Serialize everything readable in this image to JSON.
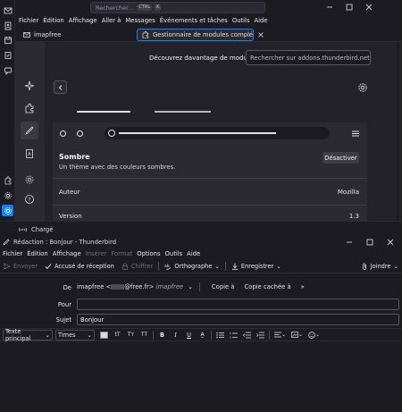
{
  "main": {
    "search_placeholder": "Rechercher…",
    "search_kbd": [
      "CTRL",
      "K"
    ],
    "menu": [
      "Fichier",
      "Édition",
      "Affichage",
      "Aller à",
      "Messages",
      "Événements et tâches",
      "Outils",
      "Aide"
    ],
    "tabs": [
      {
        "label": "imapfree",
        "icon": "mail-folder-icon"
      },
      {
        "label": "Gestionnaire de modules complém",
        "icon": "puzzle-icon"
      }
    ],
    "addons": {
      "discover_label": "Découvrez davantage de modules",
      "search_placeholder": "Rechercher sur addons.thunderbird.net",
      "theme": {
        "name": "Sombre",
        "description": "Un thème avec des couleurs sombres.",
        "disable_label": "Désactiver",
        "rows": [
          {
            "label": "Auteur",
            "value": "Mozilla"
          },
          {
            "label": "Version",
            "value": "1.3"
          }
        ]
      }
    },
    "status": "Chargé",
    "colors": {
      "accent": "#0a84ff",
      "bg": "#1c1b22",
      "panel": "#2b2a33"
    }
  },
  "compose": {
    "title": "Rédaction : Bonjour - Thunderbird",
    "menu": [
      {
        "label": "Fichier",
        "disabled": false
      },
      {
        "label": "Édition",
        "disabled": false
      },
      {
        "label": "Affichage",
        "disabled": false
      },
      {
        "label": "Insérer",
        "disabled": true
      },
      {
        "label": "Format",
        "disabled": true
      },
      {
        "label": "Options",
        "disabled": false
      },
      {
        "label": "Outils",
        "disabled": false
      },
      {
        "label": "Aide",
        "disabled": false
      }
    ],
    "toolbar": {
      "send": "Envoyer",
      "receipt": "Accusé de réception",
      "encrypt": "Chiffrer",
      "spell": "Orthographe",
      "save": "Enregistrer",
      "attach": "Joindre"
    },
    "headers": {
      "from_label": "De",
      "from_name": "imapfree <",
      "from_domain": "@free.fr>",
      "from_account": "imapfree",
      "cc": "Copie à",
      "bcc": "Copie cachée à",
      "more": "»",
      "to_label": "Pour",
      "to_value": "",
      "subject_label": "Sujet",
      "subject_value": "Bonjour"
    },
    "format": {
      "paragraph": "Texte principal",
      "font": "Times"
    }
  }
}
